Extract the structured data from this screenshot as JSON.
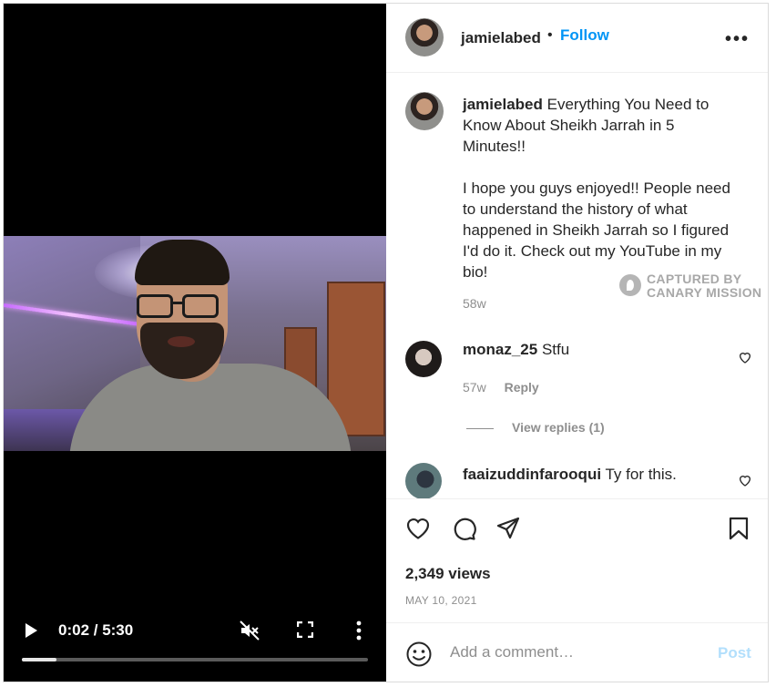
{
  "post": {
    "username": "jamielabed",
    "separator": "•",
    "follow_label": "Follow",
    "options_label": "•••"
  },
  "video": {
    "time_display": "0:02 / 5:30",
    "progress_fraction": 0.1,
    "muted": true
  },
  "caption": {
    "username": "jamielabed",
    "title": "Everything You Need to Know About Sheikh Jarrah in 5 Minutes!!",
    "body": "I hope you guys enjoyed!! People need to understand the history of what happened in Sheikh Jarrah so I figured I'd do it. Check out my YouTube in my bio!",
    "time": "58w"
  },
  "watermark": {
    "line1": "CAPTURED BY",
    "line2": "CANARY MISSION"
  },
  "comments": [
    {
      "username": "monaz_25",
      "text": "Stfu",
      "time": "57w",
      "reply_label": "Reply",
      "view_replies": "View replies (1)"
    },
    {
      "username": "faaizuddinfarooqui",
      "text": "Ty for this."
    }
  ],
  "stats": {
    "views": "2,349 views",
    "date": "MAY 10, 2021"
  },
  "add_comment": {
    "placeholder": "Add a comment…",
    "post_label": "Post"
  },
  "colors": {
    "accent": "#0095f6",
    "post_disabled": "#b2dffc",
    "muted_text": "#8e8e8e"
  }
}
